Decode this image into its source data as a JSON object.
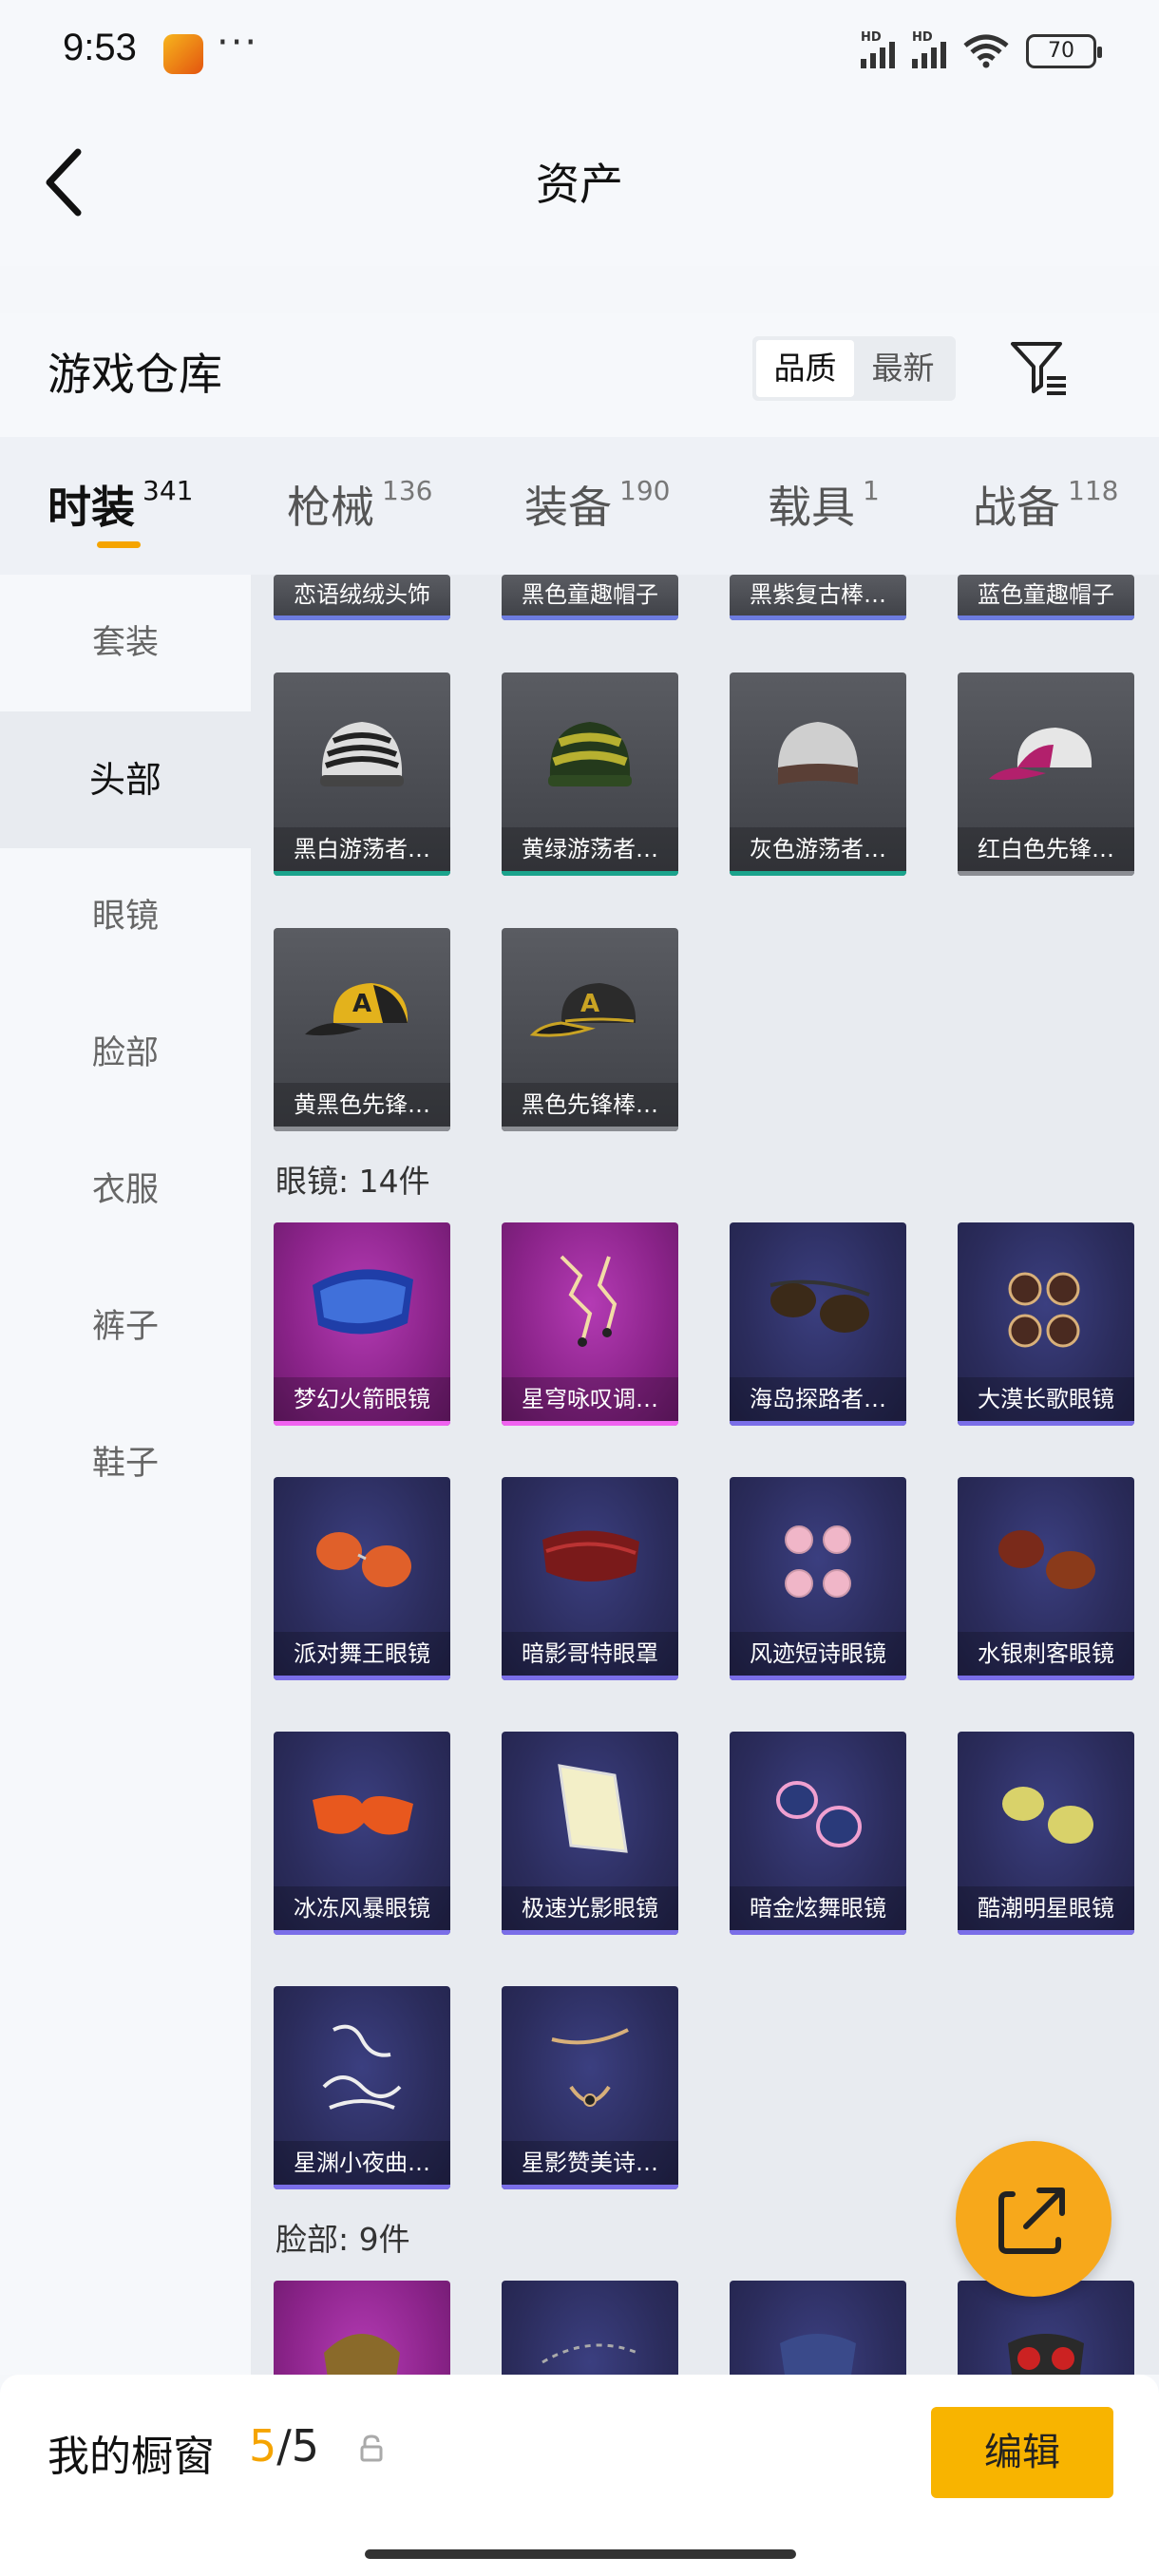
{
  "status_bar": {
    "time": "9:53",
    "dots": "···",
    "hd1": "HD",
    "hd2": "HD",
    "battery": "70"
  },
  "header": {
    "title": "资产"
  },
  "warehouse": {
    "title": "游戏仓库",
    "sort_options": [
      "品质",
      "最新"
    ],
    "sort_selected": "品质"
  },
  "tabs": [
    {
      "label": "时装",
      "count": "341"
    },
    {
      "label": "枪械",
      "count": "136"
    },
    {
      "label": "装备",
      "count": "190"
    },
    {
      "label": "载具",
      "count": "1"
    },
    {
      "label": "战备",
      "count": "118"
    }
  ],
  "sidebar": {
    "items": [
      "套装",
      "头部",
      "眼镜",
      "脸部",
      "衣服",
      "裤子",
      "鞋子"
    ],
    "active": "头部"
  },
  "content": {
    "partial_row": [
      "恋语绒绒头饰",
      "黑色童趣帽子",
      "黑紫复古棒…",
      "蓝色童趣帽子"
    ],
    "head_items": [
      "黑白游荡者…",
      "黄绿游荡者…",
      "灰色游荡者…",
      "红白色先锋…",
      "黄黑色先锋…",
      "黑色先锋棒…"
    ],
    "glasses_label": "眼镜: 14件",
    "glasses_items": [
      "梦幻火箭眼镜",
      "星穹咏叹调…",
      "海岛探路者…",
      "大漠长歌眼镜",
      "派对舞王眼镜",
      "暗影哥特眼罩",
      "风迹短诗眼镜",
      "水银刺客眼镜",
      "冰冻风暴眼镜",
      "极速光影眼镜",
      "暗金炫舞眼镜",
      "酷潮明星眼镜",
      "星渊小夜曲…",
      "星影赞美诗…"
    ],
    "face_label": "脸部: 9件"
  },
  "bottom": {
    "title": "我的橱窗",
    "current": "5",
    "separator": "/",
    "total": "5",
    "edit_label": "编辑"
  },
  "colors": {
    "accent": "#f5a400",
    "card_purple": "#2b2c5c",
    "card_pink": "#8a2389",
    "card_dark": "#4a4c52"
  }
}
